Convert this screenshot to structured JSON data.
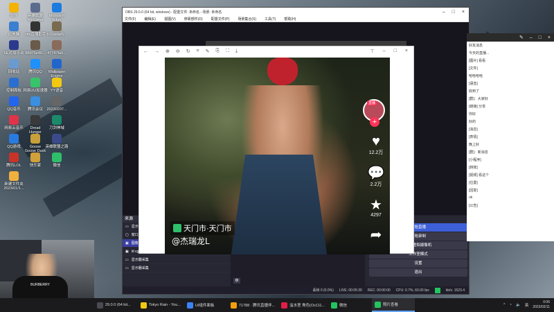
{
  "desktop": {
    "icons": [
      {
        "label": "软件"
      },
      {
        "label": "英雄联盟WeGame\n平台"
      },
      {
        "label": "Microsoft\nEdge"
      },
      {
        "label": "此电脑"
      },
      {
        "label": "obs直播助手"
      },
      {
        "label": "b12aeae5..."
      },
      {
        "label": "5E对战平台"
      },
      {
        "label": "88975e40..."
      },
      {
        "label": "47747fa5..."
      },
      {
        "label": "回收站"
      },
      {
        "label": "腾讯QQ"
      },
      {
        "label": "Wallpaper\nEngine"
      },
      {
        "label": "控制面板"
      },
      {
        "label": "网易UU加速器"
      },
      {
        "label": "YY语音"
      },
      {
        "label": "QQ音乐"
      },
      {
        "label": "腾讯会议"
      },
      {
        "label": "20230207..."
      },
      {
        "label": "网易云音乐"
      },
      {
        "label": "Dread\nHunger"
      },
      {
        "label": "刀剑神域"
      },
      {
        "label": "QQ游戏"
      },
      {
        "label": "Goose\nGoose Duck"
      },
      {
        "label": "英雄联盟之路"
      },
      {
        "label": "腾讯LOL"
      },
      {
        "label": "快乐家"
      },
      {
        "label": "微信"
      },
      {
        "label": "新建文件夹\n2023/01/1..."
      }
    ]
  },
  "obs": {
    "title": "OBS 29.0.0 (64 bit, windows) - 配置文件: 未命名 - 场景: 未命名",
    "menu": [
      "文件(F)",
      "编辑(E)",
      "视图(V)",
      "停靠部件(D)",
      "配置文件(P)",
      "场景集合(S)",
      "工具(T)",
      "帮助(H)"
    ],
    "sources_title": "来源",
    "sources": [
      "显示器采集",
      "窗口采集",
      "图像",
      "ld cg",
      "显示器采集",
      "显示器采集"
    ],
    "controls": [
      "开始直播",
      "开始录制",
      "启动虚拟摄像机",
      "工作室模式",
      "设置",
      "退出"
    ],
    "status": {
      "dropped": "丢帧 0 (0.0%)",
      "live": "LIVE: 00:05:30",
      "rec": "REC: 00:00:00",
      "cpu": "CPU: 0.7%, 60.00 fps",
      "kbps": "kb/s: 1523.4"
    }
  },
  "viewer": {
    "location": "天门市·天门市",
    "username": "@杰瑞龙L",
    "avatar_tag": "直播",
    "likes": "12.2万",
    "comments": "2.2万",
    "favorites": "4297"
  },
  "chat": {
    "lines": [
      "好友消息",
      "今天的直播...",
      "[图片] 看看",
      "[文件]",
      "哈哈哈哈",
      "[语音]",
      "收到了",
      "[群]：大家好",
      "[链接] 分享",
      "你好",
      "好的",
      "[消息]",
      "[表情]",
      "晚上好",
      "[群]：新消息",
      "[小程序]",
      "[转账]",
      "[视频] 看这个",
      "[位置]",
      "[回复]",
      "ok",
      "[公告]"
    ]
  },
  "webcam": {
    "shirt_text": "BURBERRY"
  },
  "taskbar": {
    "tasks": [
      {
        "label": "29.0.0 (64 bit...",
        "color": "#4a4a52"
      },
      {
        "label": "Tokyo Rain - You...",
        "color": "#f2c811"
      },
      {
        "label": "UI组件面板",
        "color": "#3b82f6"
      },
      {
        "label": "71788 · 腾讯直播伴...",
        "color": "#f59e0b"
      },
      {
        "label": "溢水室 角色(Ox111...",
        "color": "#e11d48"
      },
      {
        "label": "微信",
        "color": "#22c55e"
      },
      {
        "label": "照片查看",
        "color": "#22c55e"
      }
    ],
    "tray_lang": "英",
    "time": "0:06",
    "date": "2023/02/11"
  }
}
